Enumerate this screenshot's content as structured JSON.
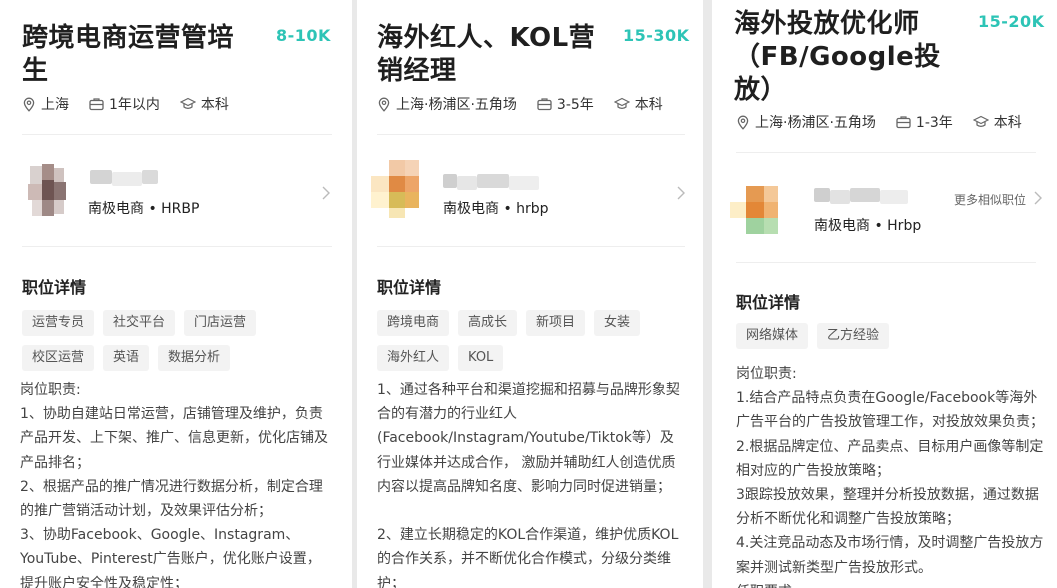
{
  "cards": [
    {
      "title": "跨境电商运营管培生",
      "salary": "8-10K",
      "location": "上海",
      "experience": "1年以内",
      "education": "本科",
      "recruiter": {
        "company_role": "南极电商 • HRBP"
      },
      "section_title": "职位详情",
      "tags": [
        "运营专员",
        "社交平台",
        "门店运营",
        "校区运营",
        "英语",
        "数据分析"
      ],
      "description": "岗位职责:\n1、协助自建站日常运营，店铺管理及维护，负责产品开发、上下架、推广、信息更新，优化店铺及产品排名；\n2、根据产品的推广情况进行数据分析，制定合理的推广营销活动计划，及效果评估分析；\n3、协助Facebook、Google、Instagram、YouTube、Pinterest广告账户，优化账户设置，提升账户安全性及稳定性；"
    },
    {
      "title": "海外红人、KOL营销经理",
      "salary": "15-30K",
      "location": "上海·杨浦区·五角场",
      "experience": "3-5年",
      "education": "本科",
      "recruiter": {
        "company_role": "南极电商 • hrbp"
      },
      "section_title": "职位详情",
      "tags": [
        "跨境电商",
        "高成长",
        "新项目",
        "女装",
        "海外红人",
        "KOL"
      ],
      "description": "1、通过各种平台和渠道挖掘和招募与品牌形象契合的有潜力的行业红人(Facebook/Instagram/Youtube/Tiktok等）及行业媒体并达成合作， 激励并辅助红人创造优质内容以提高品牌知名度、影响力同时促进销量；\n\n2、建立长期稳定的KOL合作渠道，维护优质KOL的合作关系，并不断优化合作模式，分级分类维护；"
    },
    {
      "title": "海外投放优化师（FB/Google投放）",
      "salary": "15-20K",
      "location": "上海·杨浦区·五角场",
      "experience": "1-3年",
      "education": "本科",
      "recruiter": {
        "company_role": "南极电商 • Hrbp",
        "more_label": "更多相似职位"
      },
      "section_title": "职位详情",
      "tags": [
        "网络媒体",
        "乙方经验"
      ],
      "description": "岗位职责:\n1.结合产品特点负责在Google/Facebook等海外广告平台的广告投放管理工作，对投放效果负责；\n2.根据品牌定位、产品卖点、目标用户画像等制定相对应的广告投放策略；\n3跟踪投放效果，整理并分析投放数据，通过数据分析不断优化和调整广告投放策略；\n4.关注竞品动态及市场行情，及时调整广告投放方案并测试新类型广告投放形式。\n任职要求:"
    }
  ],
  "icons": {
    "location": "location-pin-icon",
    "experience": "briefcase-icon",
    "education": "graduation-cap-icon",
    "arrow": "chevron-right-icon"
  },
  "colors": {
    "salary": "#2dc4b6",
    "tag_bg": "#f3f3f3"
  }
}
